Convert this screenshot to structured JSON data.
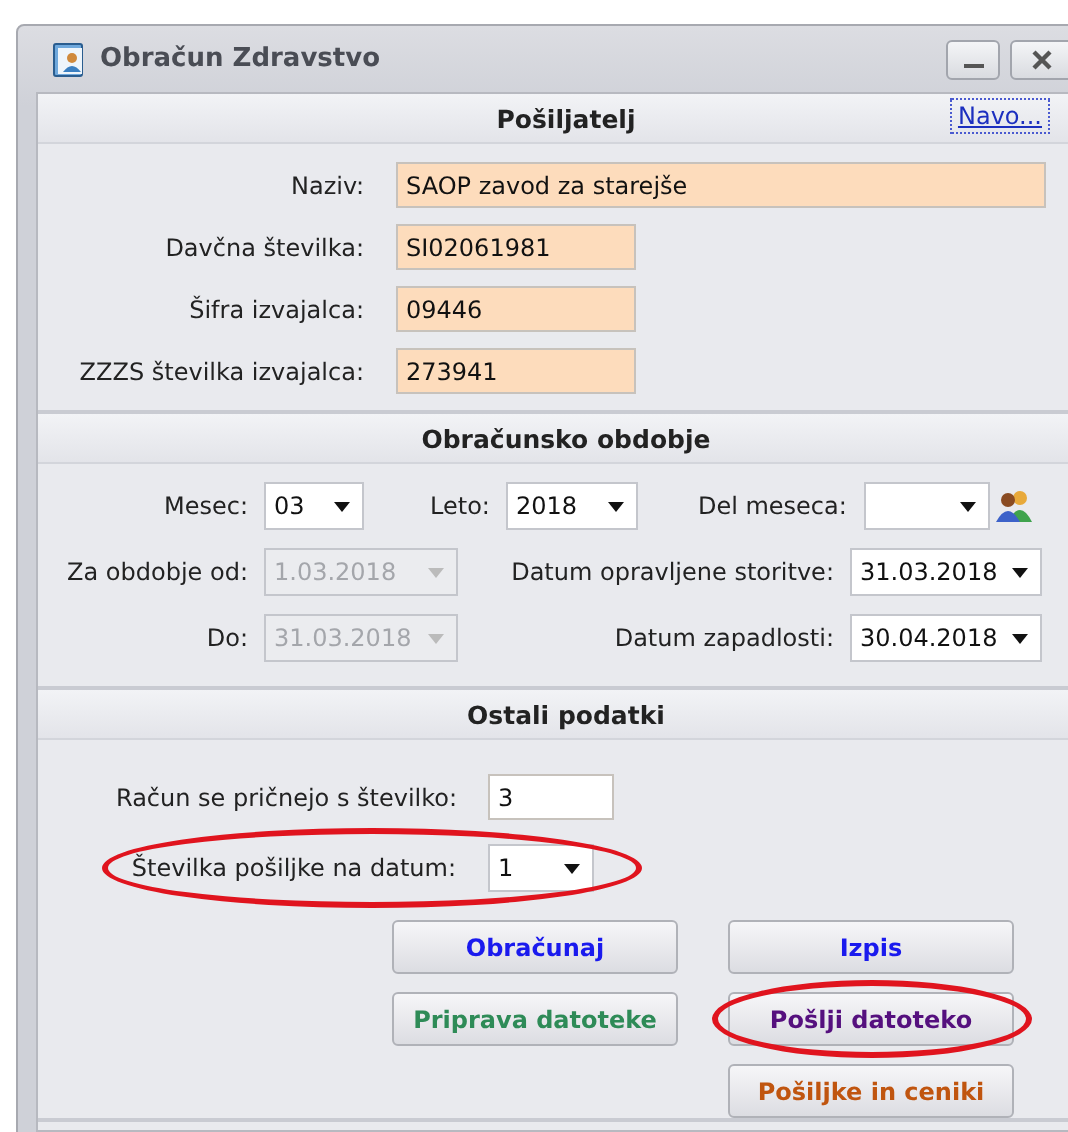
{
  "window": {
    "title": "Obračun Zdravstvo"
  },
  "sender": {
    "title": "Pošiljatelj",
    "link": "Navo...",
    "fields": [
      {
        "label": "Naziv:",
        "value": "SAOP zavod za starejše",
        "kind": "wide"
      },
      {
        "label": "Davčna številka:",
        "value": "SI02061981",
        "kind": "short"
      },
      {
        "label": "Šifra izvajalca:",
        "value": "09446",
        "kind": "short"
      },
      {
        "label": "ZZZS številka izvajalca:",
        "value": "273941",
        "kind": "short"
      }
    ]
  },
  "period": {
    "title": "Obračunsko obdobje",
    "month": {
      "label": "Mesec:",
      "value": "03"
    },
    "year": {
      "label": "Leto:",
      "value": "2018"
    },
    "part": {
      "label": "Del meseca:"
    },
    "from": {
      "label": "Za obdobje od:",
      "value": "1.03.2018",
      "disabled": true
    },
    "to": {
      "label": "Do:",
      "value": "31.03.2018",
      "disabled": true
    },
    "service_date": {
      "label": "Datum opravljene storitve:",
      "value": "31.03.2018",
      "disabled": false
    },
    "due_date": {
      "label": "Datum zapadlosti:",
      "value": "30.04.2018",
      "disabled": false
    }
  },
  "other": {
    "title": "Ostali podatki",
    "start_number": {
      "label": "Račun se pričnejo s številko:",
      "value": "3"
    },
    "shipment": {
      "label": "Številka pošiljke na datum:",
      "value": "1",
      "highlighted": true
    }
  },
  "buttons": [
    {
      "label": "Obračunaj",
      "color": "#1a1aee",
      "highlighted": false
    },
    {
      "label": "Izpis",
      "color": "#1a1aee",
      "highlighted": false
    },
    {
      "label": "Priprava datoteke",
      "color": "#2e8b57",
      "highlighted": false
    },
    {
      "label": "Pošlji datoteko",
      "color": "#55107e",
      "highlighted": true
    },
    {
      "label": "Pošiljke in ceniki",
      "color": "#c0550f",
      "highlighted": false
    }
  ]
}
